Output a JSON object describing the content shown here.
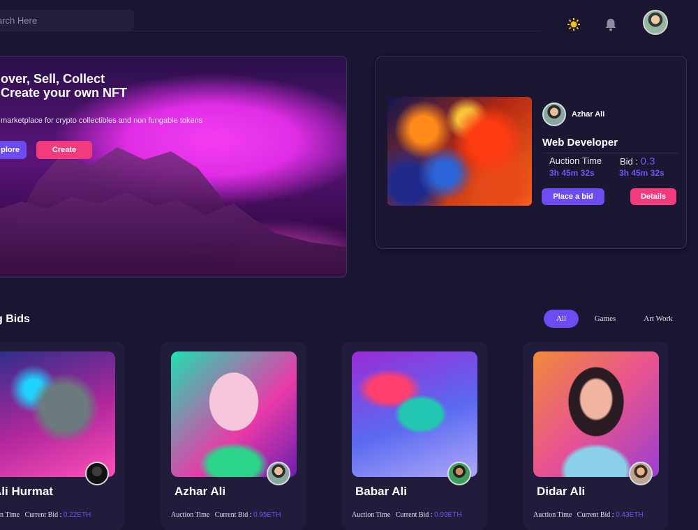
{
  "search": {
    "placeholder": "arch Here"
  },
  "header": {
    "icons": [
      "sun-icon",
      "bell-icon",
      "user-avatar"
    ]
  },
  "hero": {
    "title_line1": "over, Sell, Collect",
    "title_line2": "Create your own NFT",
    "subtitle": "marketplace for crypto collectibles and non fungable tokens",
    "explore_label": "plore",
    "create_label": "Create"
  },
  "featured": {
    "owner": "Azhar Ali",
    "role": "Web Developer",
    "auction_label": "Auction Time",
    "auction_value": "3h 45m 32s",
    "bid_label": "Bid : ",
    "bid_amount": "0.3",
    "bid_time": "3h 45m 32s",
    "place_bid_label": "Place a bid",
    "details_label": "Details"
  },
  "section": {
    "title": "g Bids",
    "filters": [
      "All",
      "Games",
      "Art Work"
    ],
    "active_filter": "All"
  },
  "cards": [
    {
      "name": "Ali Hurmat",
      "auction_label": "ction Time",
      "bid_label": "Current Bid :",
      "bid_value": "0.22ETH"
    },
    {
      "name": "Azhar Ali",
      "auction_label": "Auction Time",
      "bid_label": "Current Bid :",
      "bid_value": "0.95ETH"
    },
    {
      "name": "Babar Ali",
      "auction_label": "Auction Time",
      "bid_label": "Current Bid :",
      "bid_value": "0.99ETH"
    },
    {
      "name": "Didar Ali",
      "auction_label": "Auction Time",
      "bid_label": "Current Bid :",
      "bid_value": "0.43ETH"
    }
  ],
  "colors": {
    "accent": "#6c4cf0",
    "pink": "#f23a7e",
    "background": "#1a1530",
    "card": "#221c3c"
  }
}
